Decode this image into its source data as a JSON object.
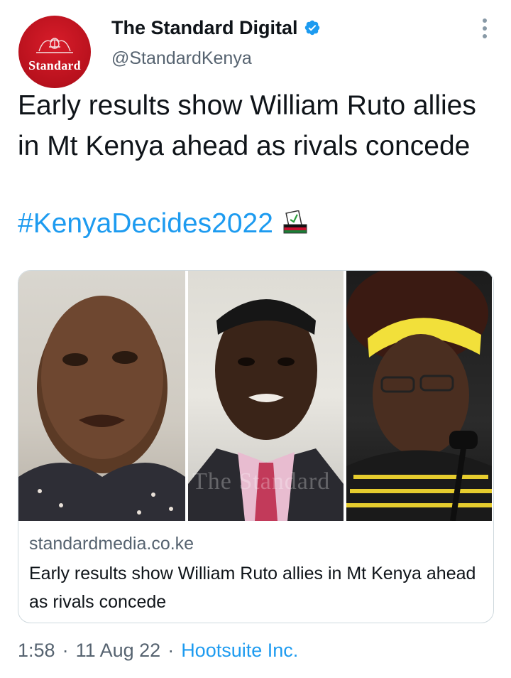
{
  "author": {
    "display_name": "The Standard Digital",
    "handle": "@StandardKenya",
    "avatar_text": "Standard",
    "verified_icon": "verified-badge-icon",
    "avatar_color": "#c0131f"
  },
  "tweet": {
    "text": "Early results show William Ruto allies in Mt Kenya ahead as rivals concede",
    "hashtag": "#KenyaDecides2022",
    "emoji_icon": "ballot-box-icon"
  },
  "card": {
    "image_watermark": "The Standard",
    "domain": "standardmedia.co.ke",
    "title": "Early results show William Ruto allies in Mt Kenya ahead as rivals concede"
  },
  "meta": {
    "time": "1:58",
    "separator": "·",
    "date": "11 Aug 22",
    "source": "Hootsuite Inc."
  },
  "colors": {
    "link": "#1d9bf0",
    "secondary_text": "#566370",
    "border": "#cfd9de"
  }
}
